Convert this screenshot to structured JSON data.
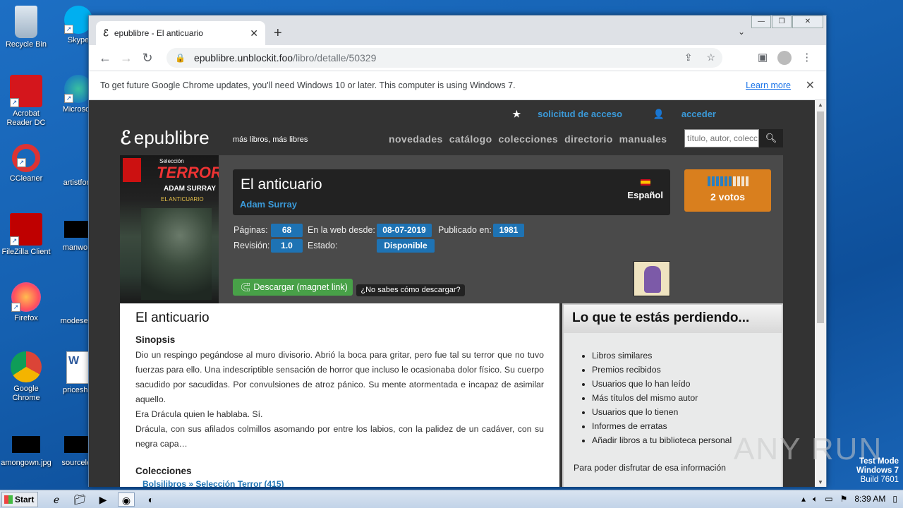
{
  "desktop": {
    "icons": [
      {
        "label": "Recycle Bin"
      },
      {
        "label": "Skype"
      },
      {
        "label": "Acrobat Reader DC"
      },
      {
        "label": "Microsoft"
      },
      {
        "label": "CCleaner"
      },
      {
        "label": "artistford"
      },
      {
        "label": "FileZilla Client"
      },
      {
        "label": "manwork"
      },
      {
        "label": "Firefox"
      },
      {
        "label": "modeseve"
      },
      {
        "label": "Google Chrome"
      },
      {
        "label": "priceshib"
      },
      {
        "label": "amongown.jpg"
      },
      {
        "label": "sourceles"
      }
    ]
  },
  "browser": {
    "tab_title": "epublibre - El anticuario",
    "url_host": "epublibre.unblockit.foo",
    "url_path": "/libro/detalle/50329",
    "infobar_text": "To get future Google Chrome updates, you'll need Windows 10 or later. This computer is using Windows 7.",
    "infobar_link": "Learn more"
  },
  "site": {
    "top_links": {
      "request": "solicitud de acceso",
      "login": "acceder"
    },
    "logo": "epublibre",
    "tagline": "más libros, más libres",
    "nav": [
      "novedades",
      "catálogo",
      "colecciones",
      "directorio",
      "manuales"
    ],
    "search_placeholder": "título, autor, colecc"
  },
  "book": {
    "cover": {
      "selection": "Selección",
      "series": "TERROR",
      "author": "ADAM SURRAY",
      "title": "EL ANTICUARIO"
    },
    "title": "El anticuario",
    "author": "Adam Surray",
    "language": "Español",
    "votes_label": "2 votos",
    "rating_fraction": 0.6,
    "pages_label": "Páginas:",
    "pages": "68",
    "web_since_label": "En la web desde:",
    "web_since": "08-07-2019",
    "published_label": "Publicado en:",
    "published": "1981",
    "revision_label": "Revisión:",
    "revision": "1.0",
    "status_label": "Estado:",
    "status": "Disponible",
    "download_label": "Descargar (magnet link)",
    "help_label": "¿No sabes cómo descargar?"
  },
  "synopsis": {
    "heading": "El anticuario",
    "subheading": "Sinopsis",
    "p1": "Dio un respingo pegándose al muro divisorio. Abrió la boca para gritar, pero fue tal su terror que no tuvo fuerzas para ello. Una indescriptible sensación de horror que incluso le ocasionaba dolor físico. Su cuerpo sacudido por sacudidas. Por convulsiones de atroz pánico. Su mente atormentada e incapaz de asimilar aquello.",
    "p2": "Era Drácula quien le hablaba. Sí.",
    "p3": "Drácula, con sus afilados colmillos asomando por entre los labios, con la palidez de un cadáver, con su negra capa…",
    "collections_heading": "Colecciones",
    "collection_link": "Bolsilibros » Selección Terror (415)"
  },
  "sidebar": {
    "heading": "Lo que te estás perdiendo...",
    "items": [
      "Libros similares",
      "Premios recibidos",
      "Usuarios que lo han leído",
      "Más títulos del mismo autor",
      "Usuarios que lo tienen",
      "Informes de erratas",
      "Añadir libros a tu biblioteca personal"
    ],
    "note": "Para poder disfrutar de esa información"
  },
  "taskbar": {
    "start": "Start",
    "clock": "8:39 AM"
  },
  "watermark": {
    "line1": "Test Mode",
    "line2": "Windows 7",
    "line3": "Build 7601",
    "brand": "ANY RUN"
  }
}
